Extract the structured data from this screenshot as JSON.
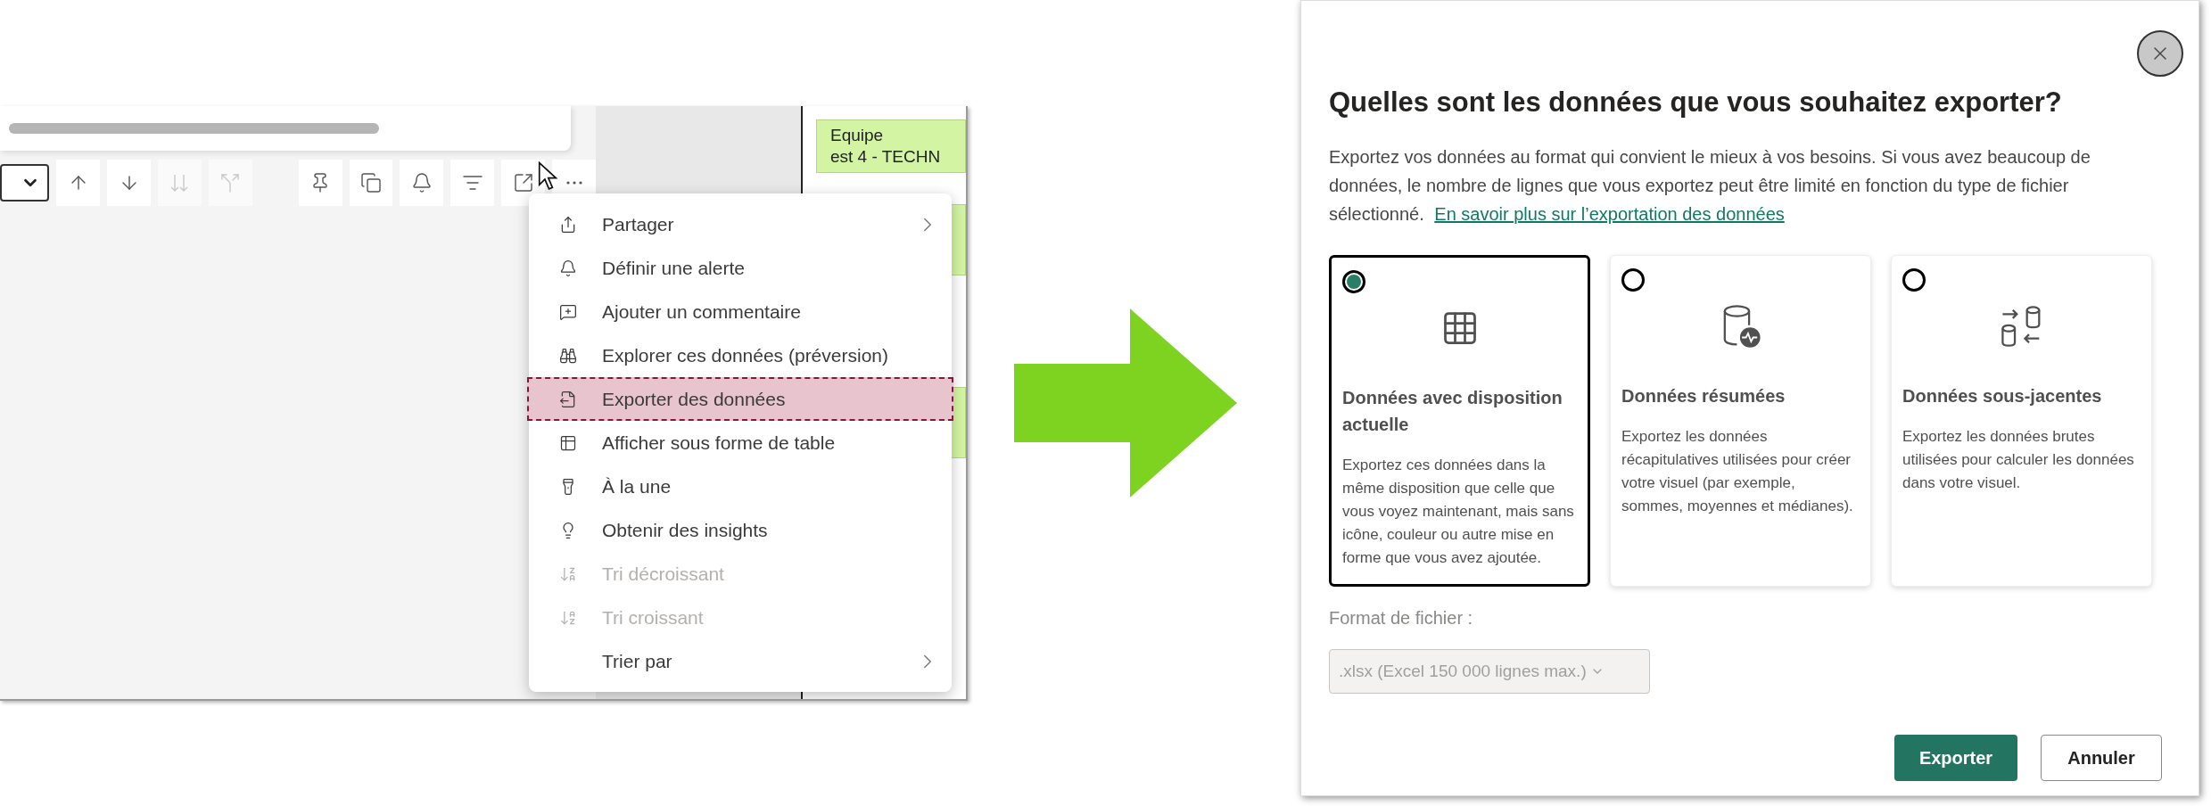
{
  "report": {
    "toolbar": [
      {
        "kind": "dropdown",
        "disabled": false
      },
      {
        "kind": "arrow-up",
        "disabled": false
      },
      {
        "kind": "arrow-down",
        "disabled": false
      },
      {
        "kind": "double-down",
        "disabled": true
      },
      {
        "kind": "hierarchy",
        "disabled": true
      },
      {
        "kind": "pin",
        "disabled": false
      },
      {
        "kind": "copy",
        "disabled": false
      },
      {
        "kind": "bell",
        "disabled": false
      },
      {
        "kind": "filter",
        "disabled": false
      },
      {
        "kind": "focus",
        "disabled": false
      },
      {
        "kind": "more",
        "disabled": false
      }
    ],
    "card": {
      "title": "Equipe",
      "value": "est 4 - TECHN"
    },
    "context_menu": [
      {
        "label": "Partager",
        "disabled": false,
        "selected": false,
        "submenu": true
      },
      {
        "label": "Définir une alerte",
        "disabled": false,
        "selected": false,
        "submenu": false
      },
      {
        "label": "Ajouter un commentaire",
        "disabled": false,
        "selected": false,
        "submenu": false
      },
      {
        "label": "Explorer ces données (préversion)",
        "disabled": false,
        "selected": false,
        "submenu": false
      },
      {
        "label": "Exporter des données",
        "disabled": false,
        "selected": true,
        "submenu": false
      },
      {
        "label": "Afficher sous forme de table",
        "disabled": false,
        "selected": false,
        "submenu": false
      },
      {
        "label": "À la une",
        "disabled": false,
        "selected": false,
        "submenu": false
      },
      {
        "label": "Obtenir des insights",
        "disabled": false,
        "selected": false,
        "submenu": false
      },
      {
        "label": "Tri décroissant",
        "disabled": true,
        "selected": false,
        "submenu": false
      },
      {
        "label": "Tri croissant",
        "disabled": true,
        "selected": false,
        "submenu": false
      },
      {
        "label": "Trier par",
        "disabled": false,
        "selected": false,
        "submenu": true
      }
    ]
  },
  "dialog": {
    "title": "Quelles sont les données que vous souhaitez exporter?",
    "description": "Exportez vos données au format qui convient le mieux à vos besoins. Si vous avez beaucoup de données, le nombre de lignes que vous exportez peut être limité en fonction du type de fichier sélectionné.",
    "link": "En savoir plus sur l’exportation des données",
    "options": [
      {
        "kind": "layout",
        "title": "Données avec disposition actuelle",
        "description": "Exportez ces données dans la même disposition que celle que vous voyez maintenant, mais sans icône, couleur ou autre mise en forme que vous avez ajoutée.",
        "selected": true
      },
      {
        "kind": "summarized",
        "title": "Données résumées",
        "description": "Exportez les données récapitulatives utilisées pour créer votre visuel (par exemple, sommes, moyennes et médianes).",
        "selected": false
      },
      {
        "kind": "underlying",
        "title": "Données sous-jacentes",
        "description": "Exportez les données brutes utilisées pour calculer les données dans votre visuel.",
        "selected": false
      }
    ],
    "format_label": "Format de fichier :",
    "format": {
      "value": ".xlsx (Excel 150 000 lignes max.)",
      "disabled": true
    },
    "buttons": [
      {
        "label": "Exporter",
        "kind": "primary"
      },
      {
        "label": "Annuler",
        "kind": "secondary"
      }
    ]
  }
}
